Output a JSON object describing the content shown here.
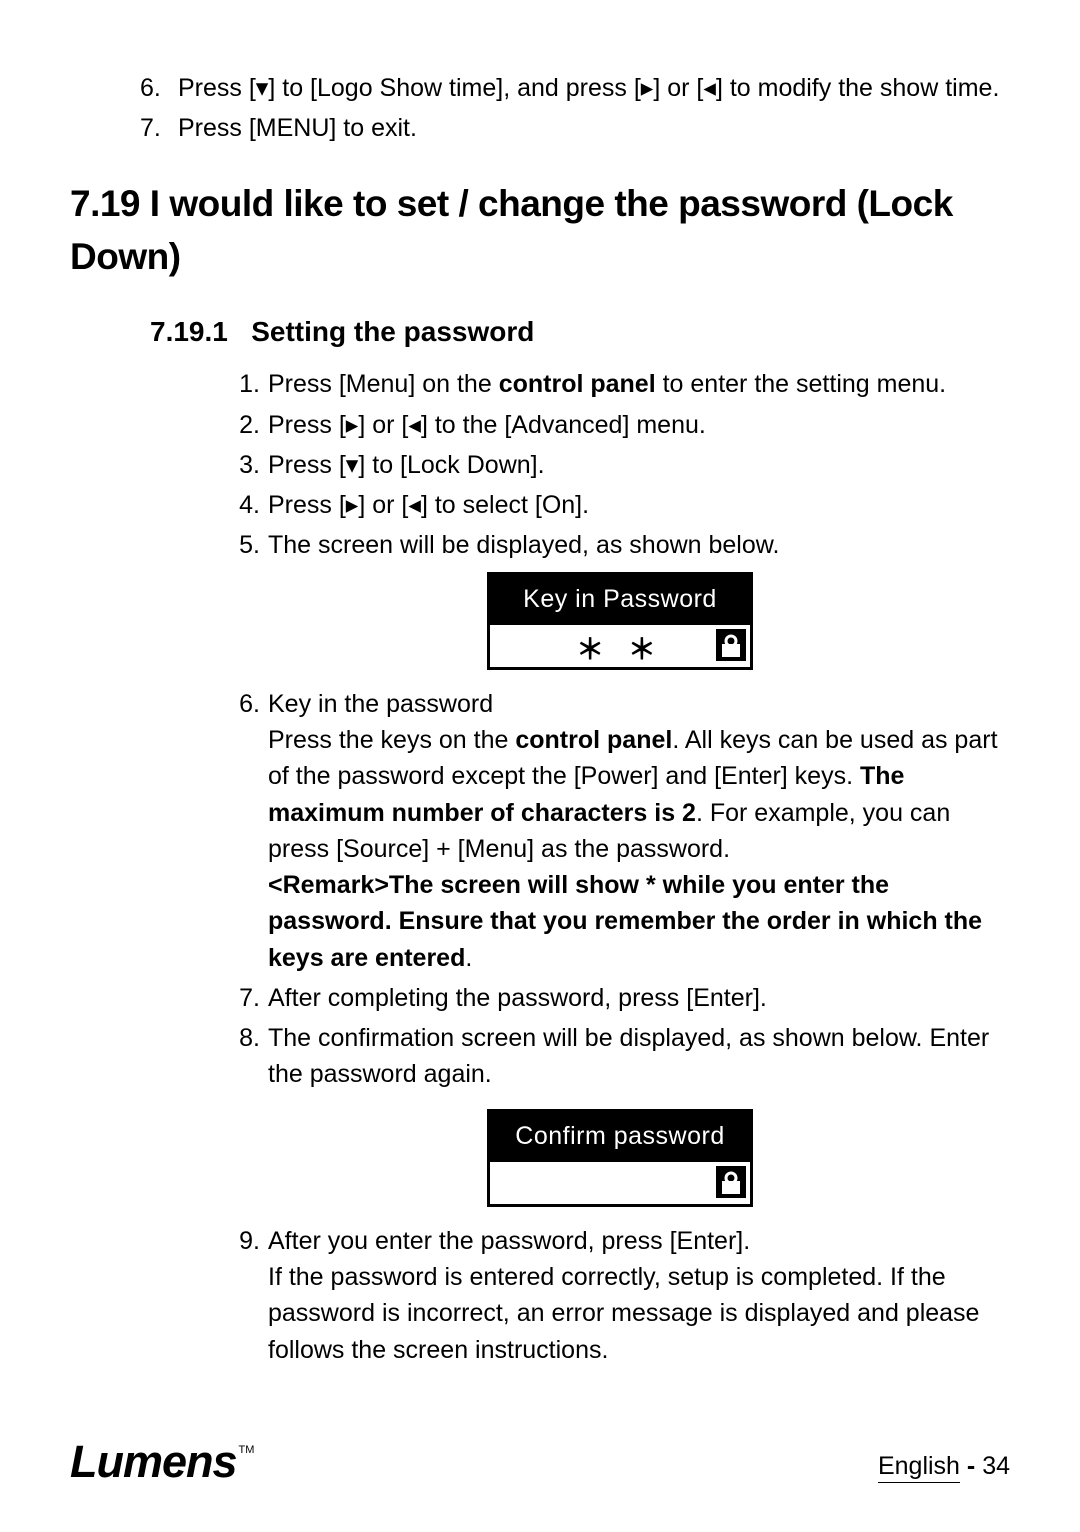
{
  "top_steps": [
    {
      "num": "6.",
      "text_before": "Press [",
      "arrow1": "▾",
      "text_mid1": "] to [Logo Show time], and press [",
      "arrow2": "▸",
      "text_mid2": "] or [",
      "arrow3": "◂",
      "text_after": "] to modify the show time."
    },
    {
      "num": "7.",
      "text_plain": "Press [MENU] to exit."
    }
  ],
  "section": {
    "number": "7.19",
    "title": "I would like to set / change the password (Lock Down)"
  },
  "subsection": {
    "number": "7.19.1",
    "title": "Setting the password"
  },
  "steps": {
    "s1": {
      "num": "1.",
      "a": "Press [Menu] on the ",
      "b_strong": "control panel",
      "c": " to enter the setting menu."
    },
    "s2": {
      "num": "2.",
      "a": "Press [",
      "arrowR": "▸",
      "b": "] or [",
      "arrowL": "◂",
      "c": "] to the [Advanced] menu."
    },
    "s3": {
      "num": "3.",
      "a": "Press [",
      "arrowD": "▾",
      "b": "] to [Lock Down]."
    },
    "s4": {
      "num": "4.",
      "a": "Press [",
      "arrowR": "▸",
      "b": "] or [",
      "arrowL": "◂",
      "c": "] to select [On]."
    },
    "s5": {
      "num": "5.",
      "text": "The screen will be displayed, as shown below."
    },
    "s6": {
      "num": "6.",
      "title": "Key in the password",
      "p1a": "Press the keys on the ",
      "p1b_strong": "control panel",
      "p1c": ". All keys can be used as part of the password except the [Power] and [Enter] keys. ",
      "p1d_strong": "The maximum number of characters is 2",
      "p1e": ". For example, you can press [Source] + [Menu] as the password.",
      "remark_strong": "<Remark>The screen will show * while you enter the password. Ensure that you remember the order in which the keys are entered",
      "remark_tail": "."
    },
    "s7": {
      "num": "7.",
      "text": "After completing the password, press [Enter]."
    },
    "s8": {
      "num": "8.",
      "text": "The confirmation screen will be displayed, as shown below. Enter the password again."
    },
    "s9": {
      "num": "9.",
      "line1": "After you enter the password, press [Enter].",
      "line2": "If the password is entered correctly, setup is completed. If the password is incorrect, an error message is displayed and please follows the screen instructions."
    }
  },
  "figures": {
    "keyin": {
      "label": "Key in Password",
      "value": "＊ ＊"
    },
    "confirm": {
      "label": "Confirm password",
      "value": ""
    }
  },
  "footer": {
    "brand": "Lumens",
    "tm": "TM",
    "language": "English",
    "sep": "  -  ",
    "page": "34"
  }
}
